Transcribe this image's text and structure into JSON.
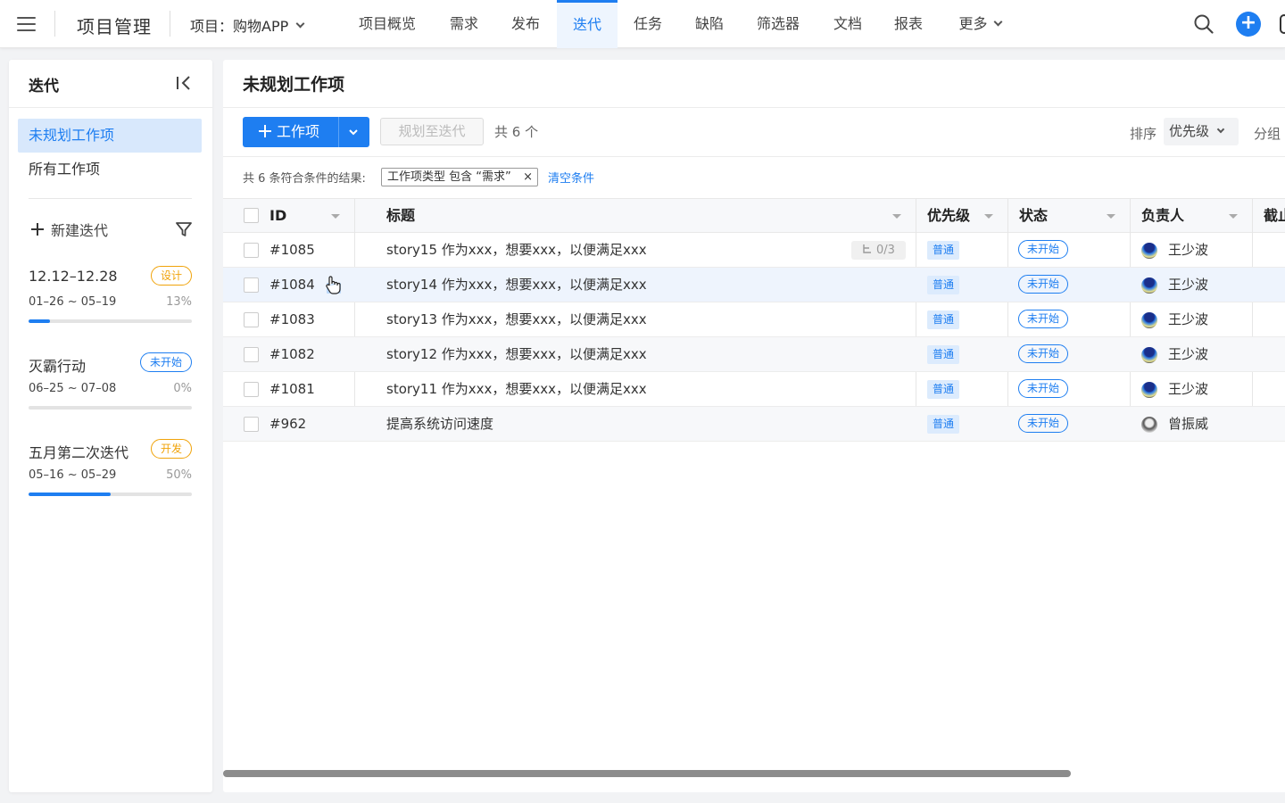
{
  "topbar": {
    "app_title": "项目管理",
    "project_select": "项目：购物APP",
    "tabs": [
      {
        "label": "项目概览"
      },
      {
        "label": "需求"
      },
      {
        "label": "发布"
      },
      {
        "label": "迭代"
      },
      {
        "label": "任务"
      },
      {
        "label": "缺陷"
      },
      {
        "label": "筛选器"
      },
      {
        "label": "文档"
      },
      {
        "label": "报表"
      },
      {
        "label": "更多"
      }
    ],
    "active_tab": "迭代",
    "plus_symbol": "+"
  },
  "sidebar": {
    "title": "迭代",
    "nav": [
      {
        "label": "未规划工作项",
        "active": true
      },
      {
        "label": "所有工作项",
        "active": false
      }
    ],
    "new_iteration_label": "新建迭代",
    "iterations": [
      {
        "name": "12.12–12.28",
        "badge": "设计",
        "dates": "01–26 ~ 05–19",
        "progress_label": "13%",
        "progress": 0.13,
        "badge_color": "#f0a30a"
      },
      {
        "name": "灭霸行动",
        "badge": "未开始",
        "dates": "06–25 ~ 07–08",
        "progress_label": "0%",
        "progress": 0.0,
        "badge_color": "#1e7ef1"
      },
      {
        "name": "五月第二次迭代",
        "badge": "开发",
        "dates": "05–16 ~ 05–29",
        "progress_label": "50%",
        "progress": 0.5,
        "badge_color": "#f0a30a"
      }
    ]
  },
  "main": {
    "title": "未规划工作项",
    "add_button_label": "工作项",
    "plan_button_label": "规划至迭代",
    "count_text": "共 6 个",
    "sort_label": "排序",
    "sort_value": "优先级",
    "group_label": "分组",
    "filter_result_text": "共 6 条符合条件的结果:",
    "filter_chip_text": "工作项类型 包含 “需求”",
    "filter_chip_close": "×",
    "clear_filter_label": "清空条件",
    "table": {
      "columns": [
        "ID",
        "标题",
        "优先级",
        "状态",
        "负责人",
        "截止"
      ],
      "rows": [
        {
          "id": "#1085",
          "title": "story15 作为xxx，想要xxx，以便满足xxx",
          "subtasks": "0/3",
          "priority": "普通",
          "status": "未开始",
          "owner": "王少波"
        },
        {
          "id": "#1084",
          "title": "story14 作为xxx，想要xxx，以便满足xxx",
          "subtasks": "",
          "priority": "普通",
          "status": "未开始",
          "owner": "王少波"
        },
        {
          "id": "#1083",
          "title": "story13 作为xxx，想要xxx，以便满足xxx",
          "subtasks": "",
          "priority": "普通",
          "status": "未开始",
          "owner": "王少波"
        },
        {
          "id": "#1082",
          "title": "story12 作为xxx，想要xxx，以便满足xxx",
          "subtasks": "",
          "priority": "普通",
          "status": "未开始",
          "owner": "王少波"
        },
        {
          "id": "#1081",
          "title": "story11 作为xxx，想要xxx，以便满足xxx",
          "subtasks": "",
          "priority": "普通",
          "status": "未开始",
          "owner": "王少波"
        },
        {
          "id": "#962",
          "title": "提高系统访问速度",
          "subtasks": "",
          "priority": "普通",
          "status": "未开始",
          "owner": "曾振威"
        }
      ]
    }
  },
  "colors": {
    "accent": "#1e7ef1",
    "badge_orange": "#f0a30a"
  }
}
